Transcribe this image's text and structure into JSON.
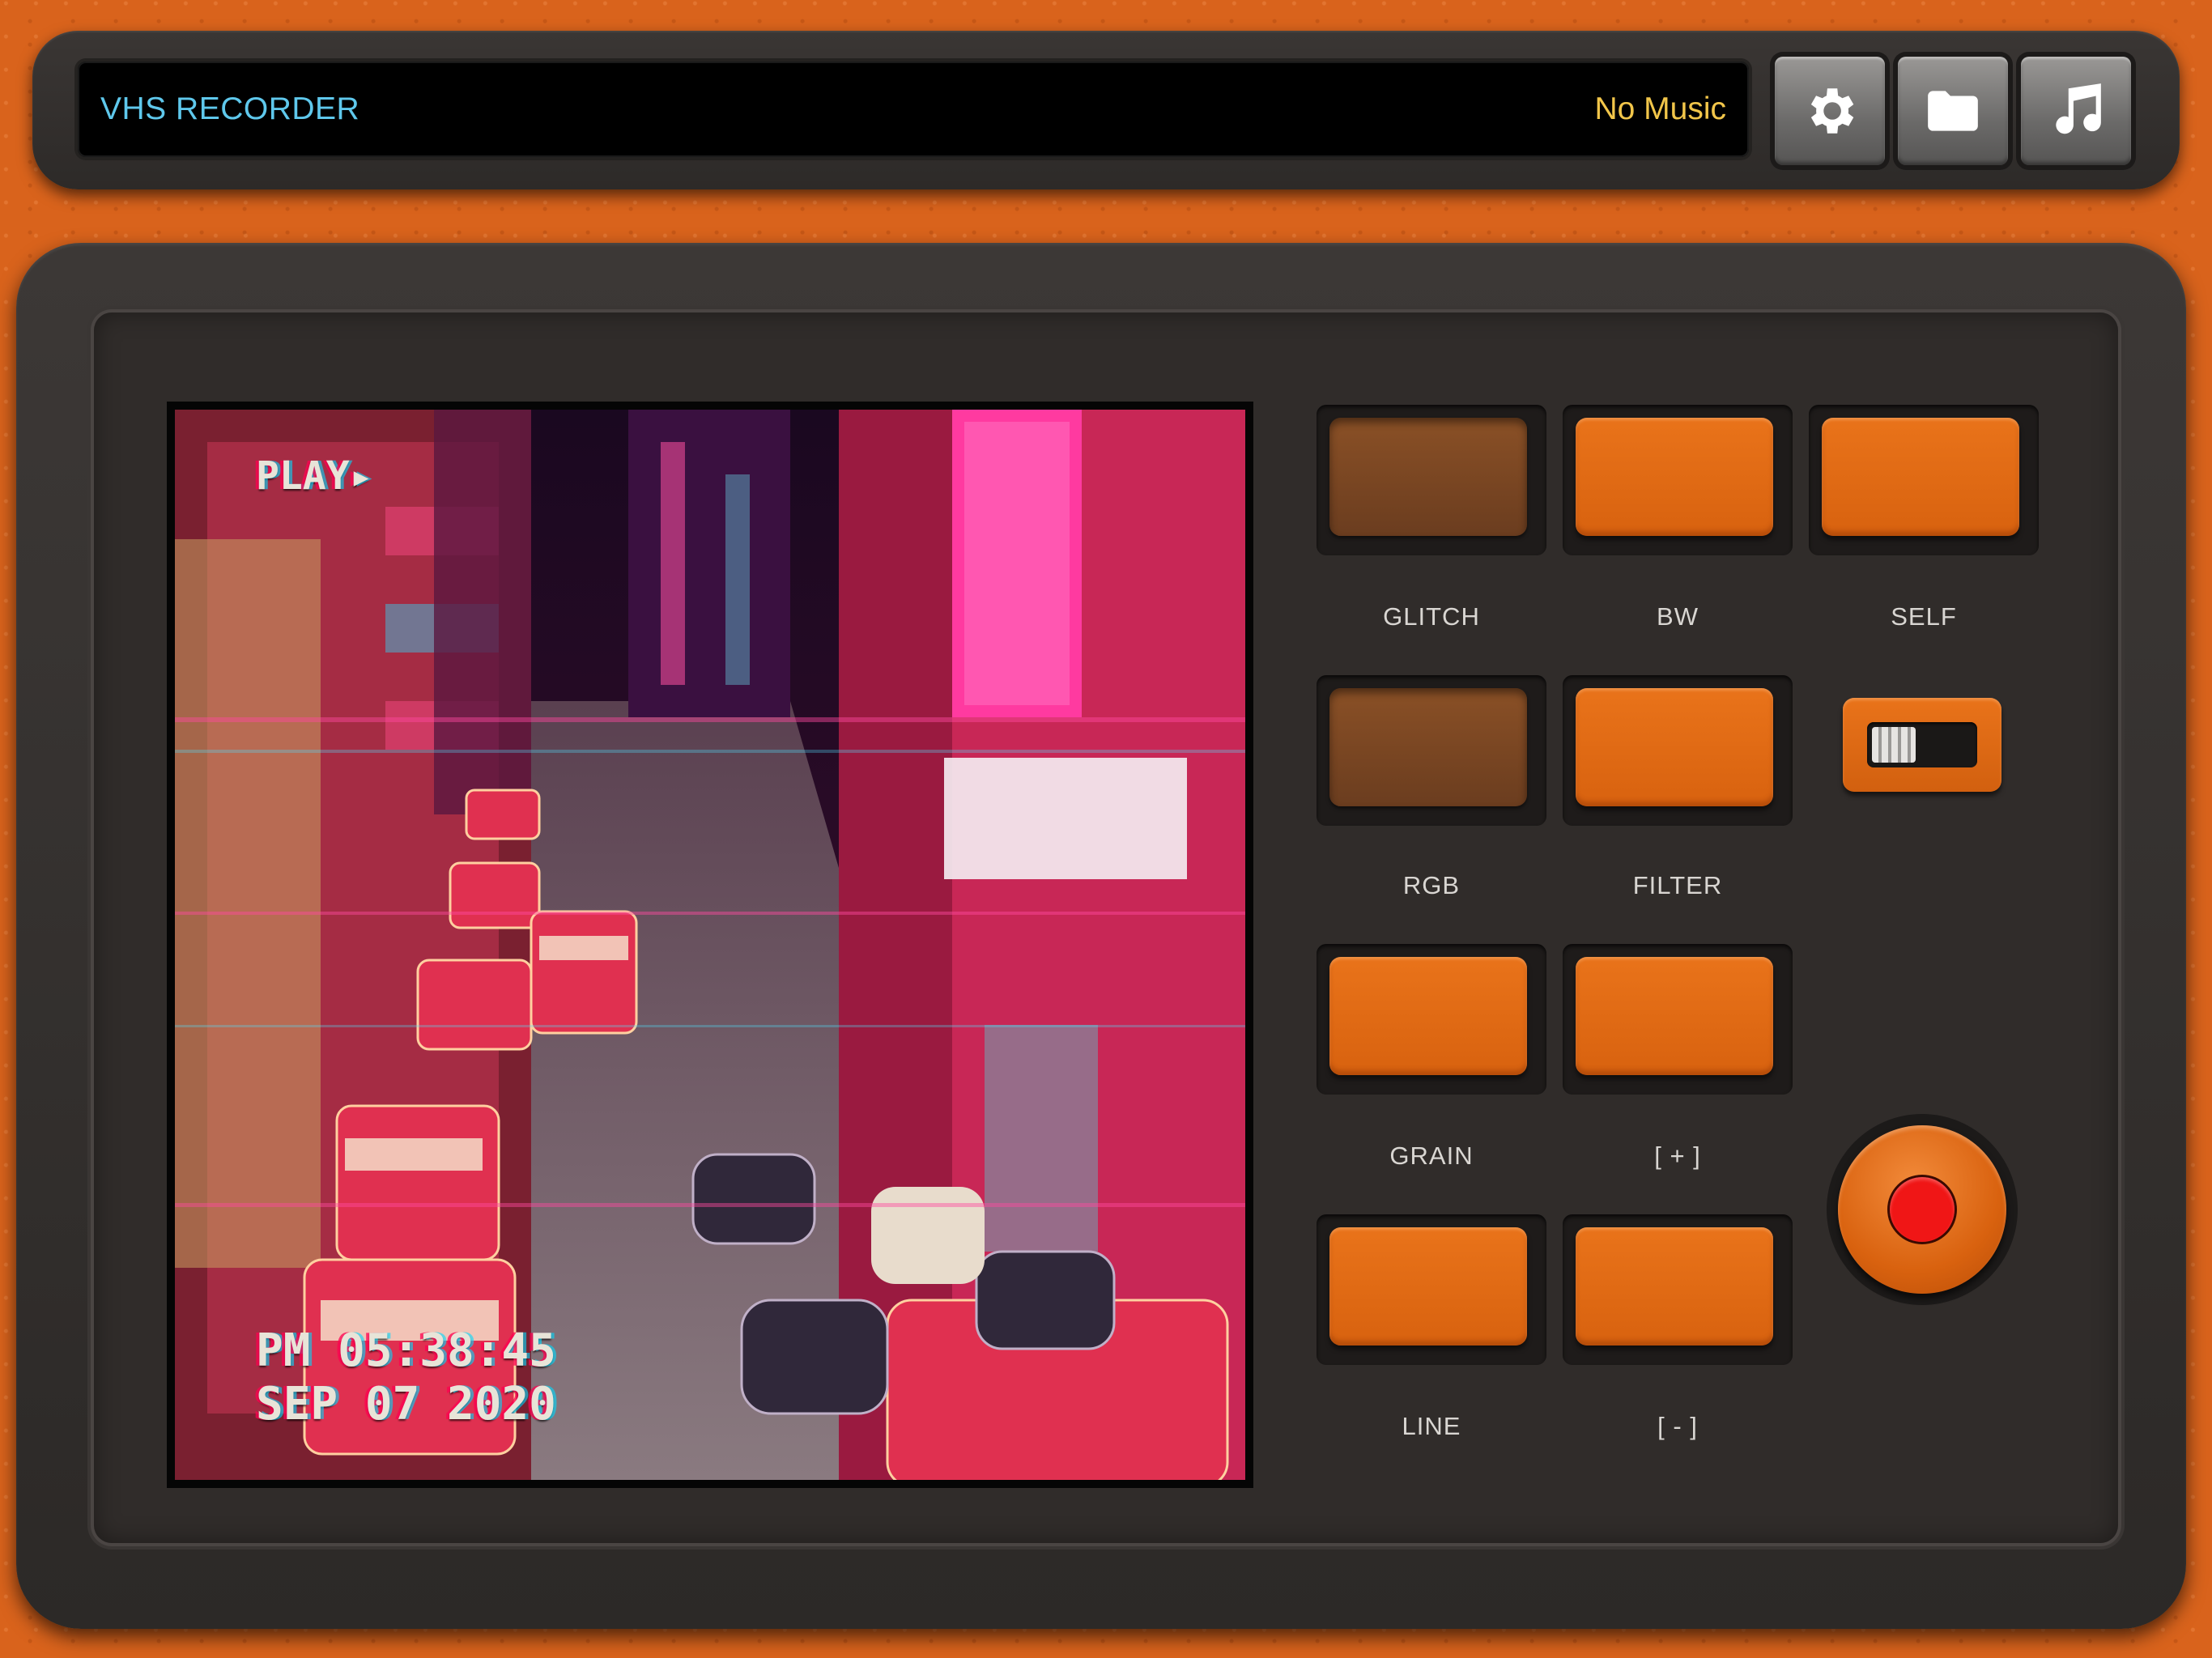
{
  "header": {
    "app_title": "VHS RECORDER",
    "music_status": "No Music",
    "buttons": [
      {
        "icon": "gear-icon"
      },
      {
        "icon": "folder-icon"
      },
      {
        "icon": "music-note-icon"
      }
    ]
  },
  "preview": {
    "osd_play": "PLAY▸",
    "osd_time": "PM 05:38:45",
    "osd_date": "SEP 07 2020"
  },
  "effects": {
    "glitch": {
      "label": "GLITCH",
      "active": false
    },
    "bw": {
      "label": "BW",
      "active": true
    },
    "self": {
      "label": "SELF",
      "active": true
    },
    "rgb": {
      "label": "RGB",
      "active": false
    },
    "filter": {
      "label": "FILTER",
      "active": true
    },
    "grain": {
      "label": "GRAIN",
      "active": true
    },
    "plus": {
      "label": "[ + ]",
      "active": true
    },
    "line": {
      "label": "LINE",
      "active": true
    },
    "minus": {
      "label": "[ - ]",
      "active": true
    }
  },
  "self_toggle": {
    "on": false
  },
  "colors": {
    "accent_orange": "#e9731a",
    "title_blue": "#5fc8ec",
    "music_yellow": "#f2c64a",
    "record_red": "#f01616"
  }
}
